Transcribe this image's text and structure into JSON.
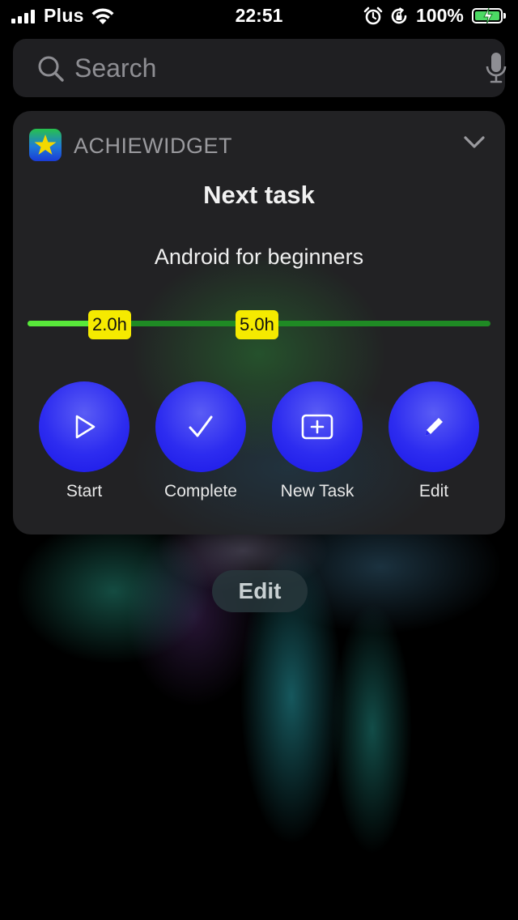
{
  "status_bar": {
    "carrier": "Plus",
    "time": "22:51",
    "battery_percent": "100%",
    "battery_level": 1.0,
    "signal_bars": 4,
    "icons": [
      "signal-icon",
      "wifi-icon",
      "alarm-icon",
      "rotation-lock-icon",
      "battery-charging-icon"
    ]
  },
  "search": {
    "placeholder": "Search",
    "icons": [
      "search-icon",
      "microphone-icon"
    ]
  },
  "widget": {
    "app_name": "ACHIEWIDGET",
    "title": "Next task",
    "task_name": "Android for beginners",
    "progress": {
      "done_label": "2.0h",
      "goal_label": "5.0h",
      "done_hours": 2.0,
      "goal_hours": 5.0
    },
    "colors": {
      "accent_blue": "#2d2cf0",
      "progress_green": "#58e83a",
      "progress_track": "#1f8a24",
      "label_yellow": "#f5ea00"
    },
    "actions": [
      {
        "label": "Start",
        "icon": "play-icon"
      },
      {
        "label": "Complete",
        "icon": "checkmark-icon"
      },
      {
        "label": "New Task",
        "icon": "add-box-icon"
      },
      {
        "label": "Edit",
        "icon": "pencil-icon"
      }
    ]
  },
  "edit_button": {
    "label": "Edit"
  }
}
